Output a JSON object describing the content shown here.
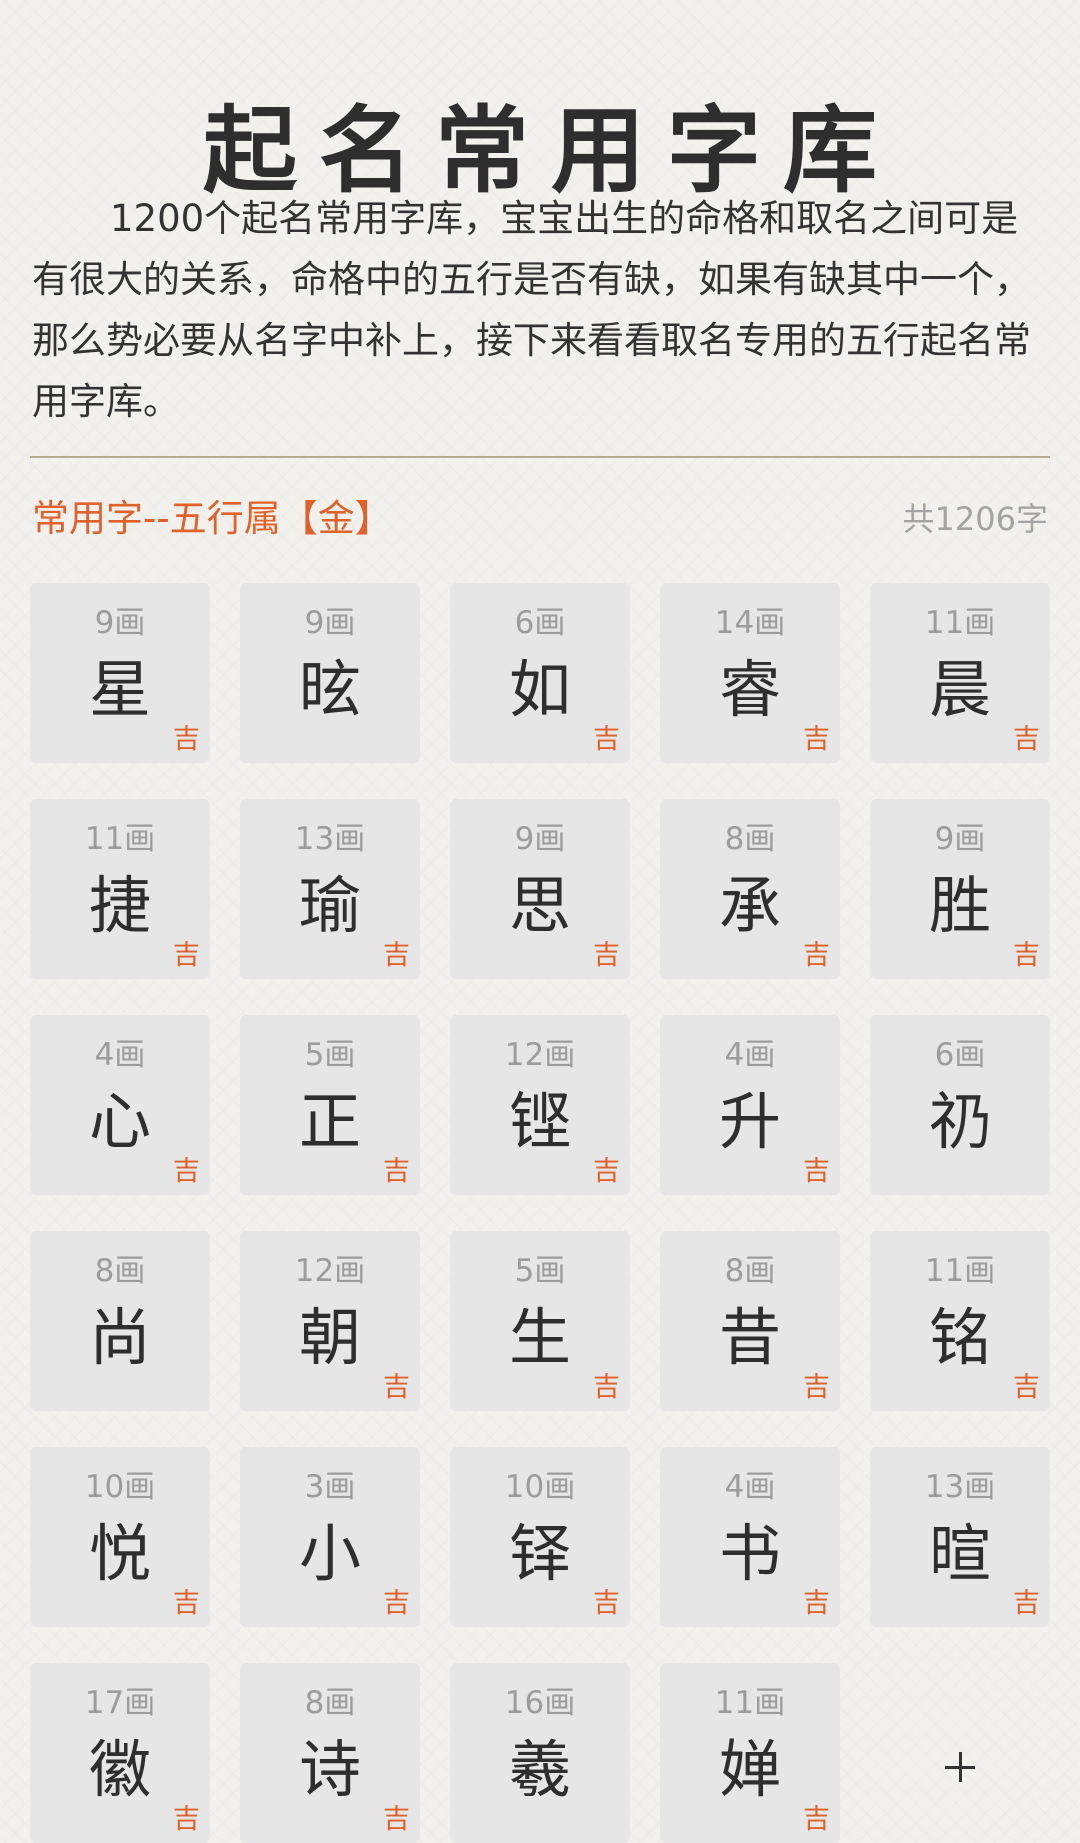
{
  "title": "起名常用字库",
  "intro": "1200个起名常用字库，宝宝出生的命格和取名之间可是有很大的关系，命格中的五行是否有缺，如果有缺其中一个，那么势必要从名字中补上，接下来看看取名专用的五行起名常用字库。",
  "section": {
    "title": "常用字--五行属【金】",
    "count": "共1206字"
  },
  "colors": {
    "accent": "#e0622a",
    "card_bg": "#e6e6e6",
    "divider": "#b9a88e"
  },
  "characters": [
    {
      "strokes": "9画",
      "char": "星",
      "luck": "吉"
    },
    {
      "strokes": "9画",
      "char": "昡",
      "luck": ""
    },
    {
      "strokes": "6画",
      "char": "如",
      "luck": "吉"
    },
    {
      "strokes": "14画",
      "char": "睿",
      "luck": "吉"
    },
    {
      "strokes": "11画",
      "char": "晨",
      "luck": "吉"
    },
    {
      "strokes": "11画",
      "char": "捷",
      "luck": "吉"
    },
    {
      "strokes": "13画",
      "char": "瑜",
      "luck": "吉"
    },
    {
      "strokes": "9画",
      "char": "思",
      "luck": "吉"
    },
    {
      "strokes": "8画",
      "char": "承",
      "luck": "吉"
    },
    {
      "strokes": "9画",
      "char": "胜",
      "luck": "吉"
    },
    {
      "strokes": "4画",
      "char": "心",
      "luck": "吉"
    },
    {
      "strokes": "5画",
      "char": "正",
      "luck": "吉"
    },
    {
      "strokes": "12画",
      "char": "铿",
      "luck": "吉"
    },
    {
      "strokes": "4画",
      "char": "升",
      "luck": "吉"
    },
    {
      "strokes": "6画",
      "char": "礽",
      "luck": ""
    },
    {
      "strokes": "8画",
      "char": "尚",
      "luck": ""
    },
    {
      "strokes": "12画",
      "char": "朝",
      "luck": "吉"
    },
    {
      "strokes": "5画",
      "char": "生",
      "luck": "吉"
    },
    {
      "strokes": "8画",
      "char": "昔",
      "luck": "吉"
    },
    {
      "strokes": "11画",
      "char": "铭",
      "luck": "吉"
    },
    {
      "strokes": "10画",
      "char": "悦",
      "luck": "吉"
    },
    {
      "strokes": "3画",
      "char": "小",
      "luck": "吉"
    },
    {
      "strokes": "10画",
      "char": "铎",
      "luck": "吉"
    },
    {
      "strokes": "4画",
      "char": "书",
      "luck": "吉"
    },
    {
      "strokes": "13画",
      "char": "暄",
      "luck": "吉"
    },
    {
      "strokes": "17画",
      "char": "徽",
      "luck": "吉"
    },
    {
      "strokes": "8画",
      "char": "诗",
      "luck": "吉"
    },
    {
      "strokes": "16画",
      "char": "羲",
      "luck": ""
    },
    {
      "strokes": "11画",
      "char": "婵",
      "luck": "吉"
    }
  ],
  "add_label": "+"
}
